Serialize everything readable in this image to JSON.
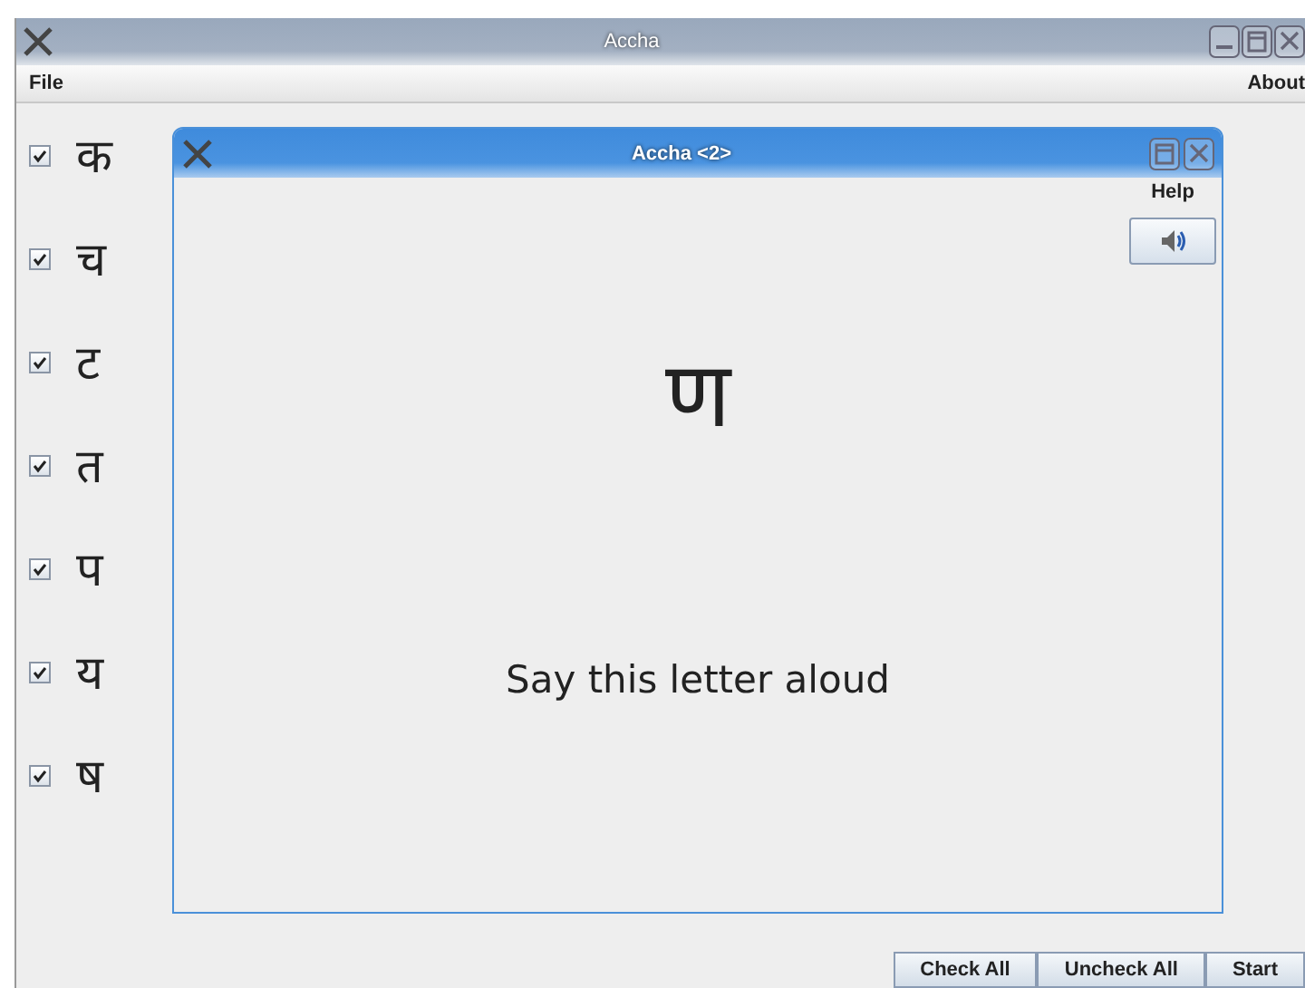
{
  "window": {
    "title": "Accha"
  },
  "menu": [
    {
      "label": "File"
    },
    {
      "label": "About"
    }
  ],
  "letters": [
    {
      "label": "क",
      "checked": true
    },
    {
      "label": "च",
      "checked": true
    },
    {
      "label": "ट",
      "checked": true
    },
    {
      "label": "त",
      "checked": true
    },
    {
      "label": "प",
      "checked": true
    },
    {
      "label": "य",
      "checked": true
    },
    {
      "label": "ष",
      "checked": true
    }
  ],
  "dialog": {
    "title": "Accha <2>",
    "help": "Help",
    "letter": "ण",
    "prompt": "Say this letter aloud"
  },
  "buttons": [
    "Check All",
    "Uncheck All",
    "Start"
  ]
}
